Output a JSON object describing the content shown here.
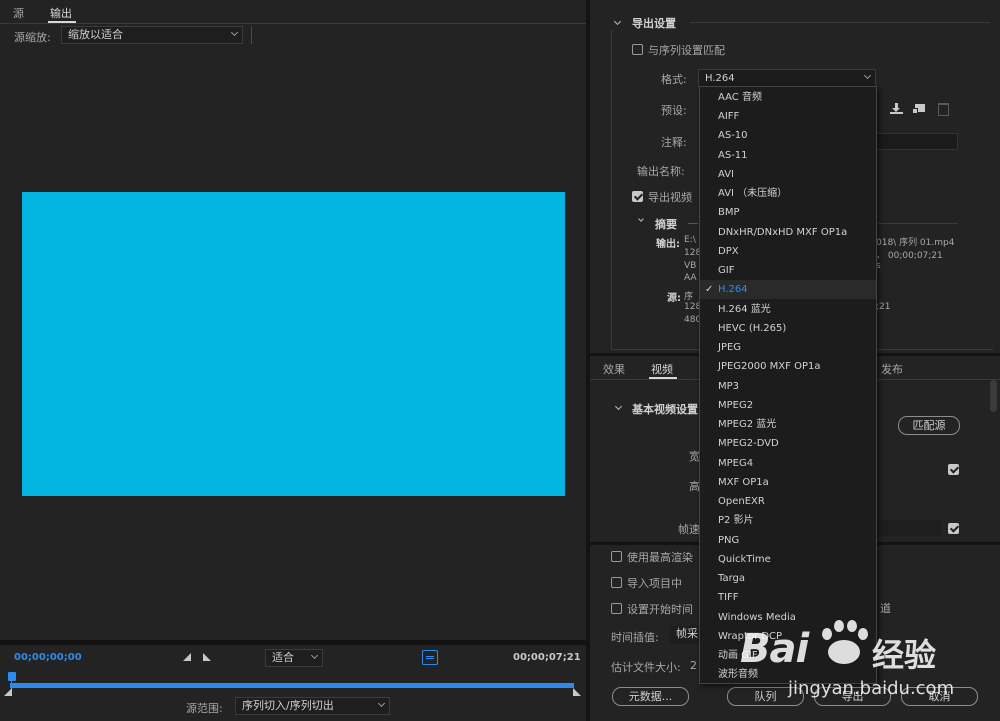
{
  "left_panel": {
    "tabs": [
      {
        "label": "源"
      },
      {
        "label": "输出"
      }
    ],
    "source_scale_label": "源缩放:",
    "source_scale_value": "缩放以适合",
    "preview_color": "#03b5e0",
    "timecode_start": "00;00;00;00",
    "timecode_end": "00;00;07;21",
    "zoom_value": "适合",
    "source_range_label": "源范围:",
    "source_range_value": "序列切入/序列切出"
  },
  "export_settings": {
    "section_title": "导出设置",
    "match_sequence_label": "与序列设置匹配",
    "format_label": "格式:",
    "format_value": "H.264",
    "preset_label": "预设:",
    "comments_label": "注释:",
    "output_name_label": "输出名称:",
    "export_video_label": "导出视频",
    "summary_title": "摘要",
    "output_label": "输出:",
    "output_lines_left": [
      "E:\\",
      "128",
      "VB",
      "AA"
    ],
    "output_lines_right": [
      "018\\ 序列 01.mp4",
      "， 00;00;07;21",
      "s"
    ],
    "source_label": "源:",
    "source_lines_left": [
      "序",
      "128",
      "480"
    ],
    "source_lines_right": [
      ";21"
    ]
  },
  "tabs_row": [
    {
      "label": "效果"
    },
    {
      "label": "视频"
    },
    {
      "label": "发布"
    }
  ],
  "video_settings": {
    "section_title": "基本视频设置",
    "match_source_label": "匹配源",
    "width_label": "宽",
    "height_label": "高",
    "frame_rate_label": "帧速"
  },
  "bottom_options": {
    "max_render_label": "使用最高渲染",
    "import_project_label": "导入项目中",
    "set_start_time_label": "设置开始时间",
    "right_tail_text": "道",
    "time_interp_label": "时间插值:",
    "time_interp_value": "帧采",
    "file_size_label": "估计文件大小:",
    "file_size_value": "2",
    "metadata_button": "元数据...",
    "queue_button": "队列",
    "export_button": "导出",
    "cancel_button": "取消"
  },
  "format_menu": {
    "items": [
      "AAC 音频",
      "AIFF",
      "AS-10",
      "AS-11",
      "AVI",
      "AVI （未压缩）",
      "BMP",
      "DNxHR/DNxHD MXF OP1a",
      "DPX",
      "GIF",
      "H.264",
      "H.264 蓝光",
      "HEVC (H.265)",
      "JPEG",
      "JPEG2000 MXF OP1a",
      "MP3",
      "MPEG2",
      "MPEG2 蓝光",
      "MPEG2-DVD",
      "MPEG4",
      "MXF OP1a",
      "OpenEXR",
      "P2 影片",
      "PNG",
      "QuickTime",
      "Targa",
      "TIFF",
      "Windows Media",
      "Wraptor DCP",
      "动画 GIF",
      "波形音频"
    ],
    "selected": "H.264",
    "checkmark": "✓"
  },
  "watermark": {
    "brand": "Bai",
    "brand_tail": "经验",
    "url": "jingyan.baidu.com"
  },
  "colors": {
    "accent": "#2d8ceb",
    "panel": "#232323",
    "preview": "#03b5e0"
  }
}
